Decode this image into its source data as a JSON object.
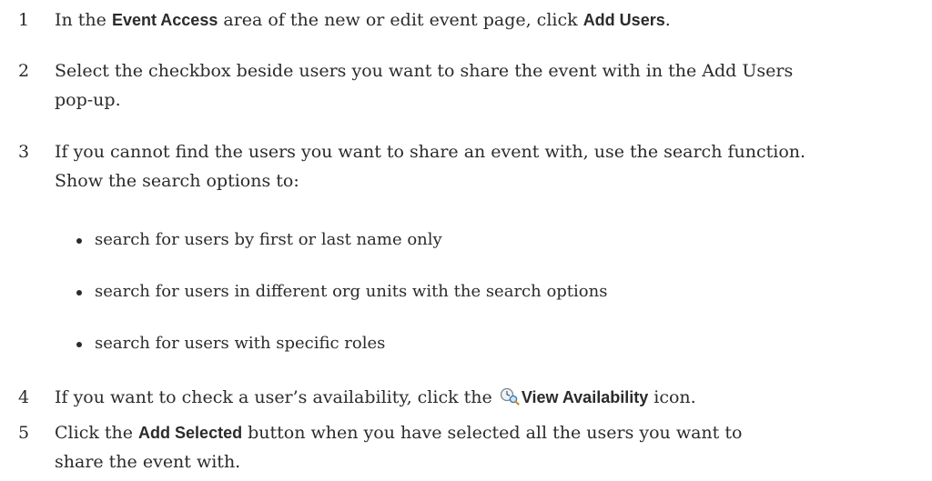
{
  "steps": [
    {
      "number": "1",
      "pre": "In the ",
      "bold1": "Event Access",
      "mid": " area of the new or edit event page, click ",
      "bold2": "Add Users",
      "post": "."
    },
    {
      "number": "2",
      "line1": "Select the checkbox beside users you want to share the event with in the Add Users",
      "line2": "pop-up."
    },
    {
      "number": "3",
      "line1": "If you cannot find the users you want to share an event with, use the search function.",
      "line2": "Show the search options to:",
      "bullets": [
        "search for users by first or last name only",
        "search for users in different org units with the search options",
        "search for users with specific roles"
      ]
    },
    {
      "number": "4",
      "pre": "If you want to check a user’s availability, click the ",
      "bold": "View Availability",
      "post": " icon."
    },
    {
      "number": "5",
      "pre": "Click the ",
      "bold": "Add Selected",
      "post1": " button when you have selected all the users you want to",
      "line2": "share the event with."
    }
  ],
  "icons": {
    "view_availability": "clock-magnifier-icon"
  }
}
